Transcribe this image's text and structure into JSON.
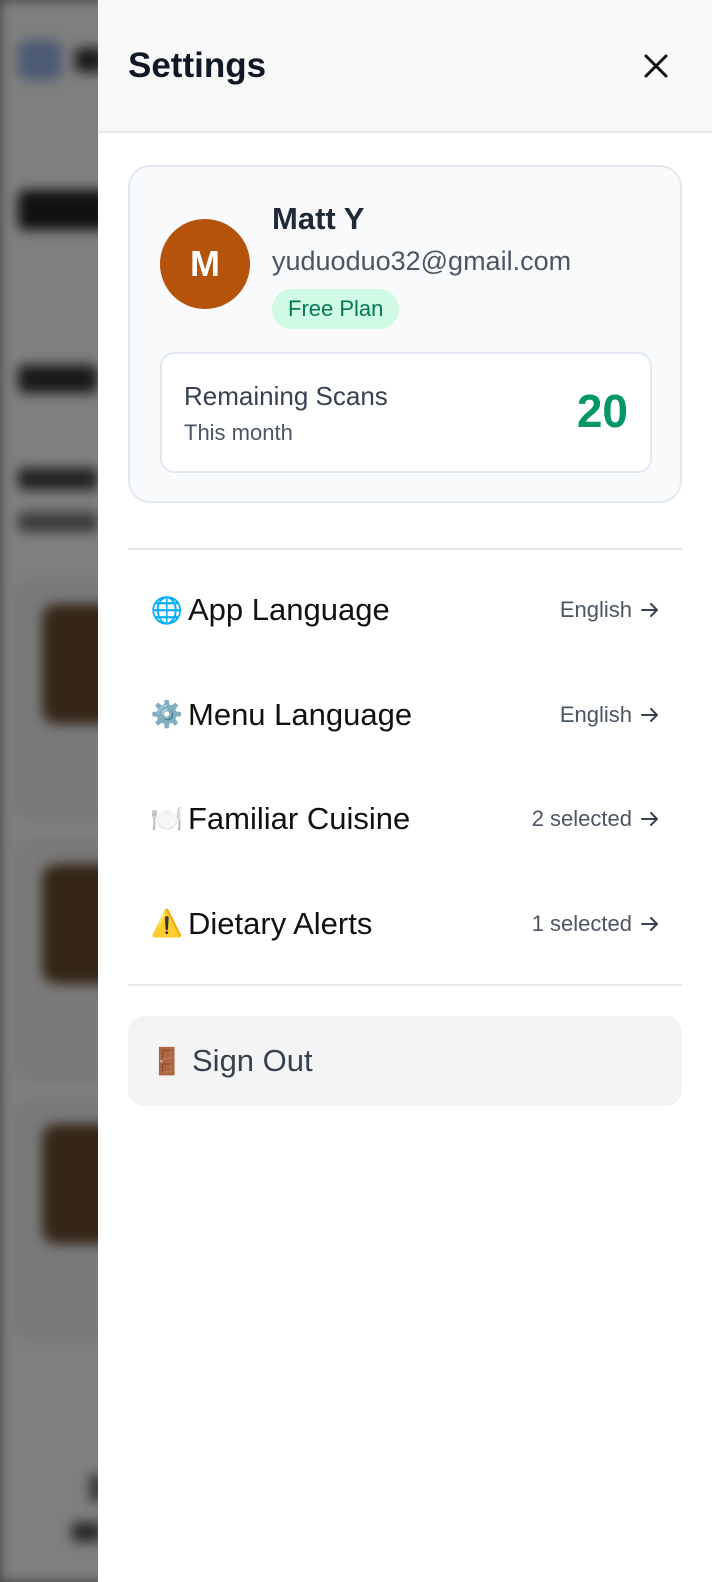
{
  "header": {
    "title": "Settings",
    "close_icon": "close-icon"
  },
  "profile": {
    "avatar_initial": "M",
    "avatar_color": "#b45309",
    "name": "Matt Y",
    "email": "yuduoduo32@gmail.com",
    "plan": "Free Plan"
  },
  "scans": {
    "label": "Remaining Scans",
    "period": "This month",
    "value": "20",
    "value_color": "#059669"
  },
  "settings": [
    {
      "icon": "globe-icon",
      "glyph": "🌐",
      "label": "App Language",
      "value": "English"
    },
    {
      "icon": "gear-icon",
      "glyph": "⚙️",
      "label": "Menu Language",
      "value": "English"
    },
    {
      "icon": "plate-icon",
      "glyph": "🍽️",
      "label": "Familiar Cuisine",
      "value": "2 selected"
    },
    {
      "icon": "warning-icon",
      "glyph": "⚠️",
      "label": "Dietary Alerts",
      "value": "1 selected"
    }
  ],
  "signout": {
    "icon": "door-icon",
    "glyph": "🚪",
    "label": "Sign Out"
  }
}
